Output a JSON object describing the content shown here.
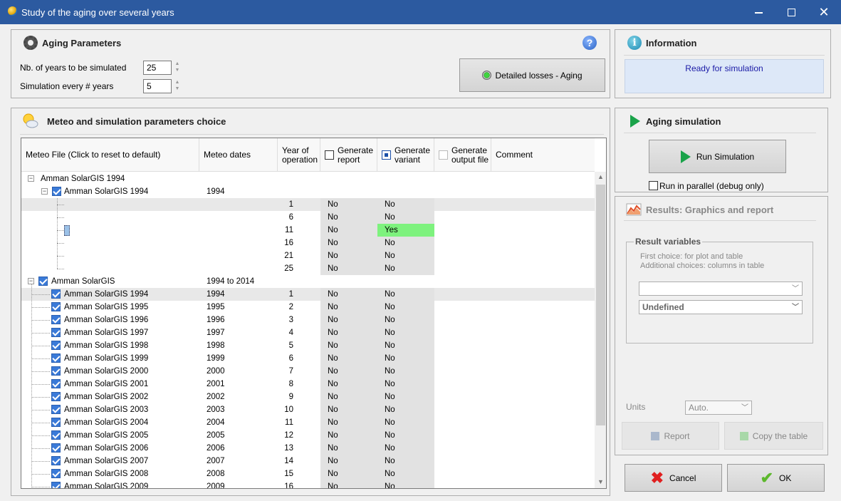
{
  "window": {
    "title": "Study of the aging over several years",
    "minimize": "—",
    "maximize": "□",
    "close": "✕"
  },
  "aging_params": {
    "title": "Aging Parameters",
    "help": "?",
    "years_label": "Nb. of years to be simulated",
    "years_value": "25",
    "every_label": "Simulation every # years",
    "every_value": "5",
    "detailed_losses_button": "Detailed losses - Aging"
  },
  "information": {
    "title": "Information",
    "status": "Ready for simulation"
  },
  "meteo": {
    "title": "Meteo and simulation parameters choice",
    "columns": {
      "meteo_file": "Meteo File (Click to reset to default)",
      "meteo_dates": "Meteo dates",
      "year_of_op_1": "Year of",
      "year_of_op_2": "operation",
      "gen_report_1": "Generate",
      "gen_report_2": "report",
      "gen_variant_1": "Generate",
      "gen_variant_2": "variant",
      "gen_output_1": "Generate",
      "gen_output_2": "output file",
      "comment": "Comment"
    },
    "group1": {
      "root": "Amman SolarGIS 1994",
      "child": "Amman SolarGIS 1994",
      "child_dates": "1994",
      "rows": [
        {
          "year": "1",
          "report": "No",
          "variant": "No"
        },
        {
          "year": "6",
          "report": "No",
          "variant": "No"
        },
        {
          "year": "11",
          "report": "No",
          "variant": "Yes"
        },
        {
          "year": "16",
          "report": "No",
          "variant": "No"
        },
        {
          "year": "21",
          "report": "No",
          "variant": "No"
        },
        {
          "year": "25",
          "report": "No",
          "variant": "No"
        }
      ]
    },
    "group2": {
      "root": "Amman SolarGIS",
      "root_dates": "1994 to 2014",
      "rows": [
        {
          "name": "Amman SolarGIS 1994",
          "dates": "1994",
          "year": "1",
          "report": "No",
          "variant": "No"
        },
        {
          "name": "Amman SolarGIS 1995",
          "dates": "1995",
          "year": "2",
          "report": "No",
          "variant": "No"
        },
        {
          "name": "Amman SolarGIS 1996",
          "dates": "1996",
          "year": "3",
          "report": "No",
          "variant": "No"
        },
        {
          "name": "Amman SolarGIS 1997",
          "dates": "1997",
          "year": "4",
          "report": "No",
          "variant": "No"
        },
        {
          "name": "Amman SolarGIS 1998",
          "dates": "1998",
          "year": "5",
          "report": "No",
          "variant": "No"
        },
        {
          "name": "Amman SolarGIS 1999",
          "dates": "1999",
          "year": "6",
          "report": "No",
          "variant": "No"
        },
        {
          "name": "Amman SolarGIS 2000",
          "dates": "2000",
          "year": "7",
          "report": "No",
          "variant": "No"
        },
        {
          "name": "Amman SolarGIS 2001",
          "dates": "2001",
          "year": "8",
          "report": "No",
          "variant": "No"
        },
        {
          "name": "Amman SolarGIS 2002",
          "dates": "2002",
          "year": "9",
          "report": "No",
          "variant": "No"
        },
        {
          "name": "Amman SolarGIS 2003",
          "dates": "2003",
          "year": "10",
          "report": "No",
          "variant": "No"
        },
        {
          "name": "Amman SolarGIS 2004",
          "dates": "2004",
          "year": "11",
          "report": "No",
          "variant": "No"
        },
        {
          "name": "Amman SolarGIS 2005",
          "dates": "2005",
          "year": "12",
          "report": "No",
          "variant": "No"
        },
        {
          "name": "Amman SolarGIS 2006",
          "dates": "2006",
          "year": "13",
          "report": "No",
          "variant": "No"
        },
        {
          "name": "Amman SolarGIS 2007",
          "dates": "2007",
          "year": "14",
          "report": "No",
          "variant": "No"
        },
        {
          "name": "Amman SolarGIS 2008",
          "dates": "2008",
          "year": "15",
          "report": "No",
          "variant": "No"
        },
        {
          "name": "Amman SolarGIS 2009",
          "dates": "2009",
          "year": "16",
          "report": "No",
          "variant": "No"
        }
      ]
    }
  },
  "aging_sim": {
    "title": "Aging simulation",
    "run_button": "Run Simulation",
    "parallel_label": "Run in parallel (debug only)"
  },
  "results": {
    "title": "Results: Graphics and report",
    "group_title": "Result variables",
    "first_choice": "First choice:   for plot and table",
    "additional": "Additional  choices: columns in table",
    "combo1": "",
    "combo2": "Undefined",
    "units_label": "Units",
    "units_value": "Auto.",
    "report_button": "Report",
    "copy_button": "Copy the table"
  },
  "footer": {
    "cancel": "Cancel",
    "ok": "OK"
  },
  "colors": {
    "titlebar": "#2c5aa0",
    "yes_highlight": "#7ef27e",
    "info_text": "#1a1aa6"
  }
}
